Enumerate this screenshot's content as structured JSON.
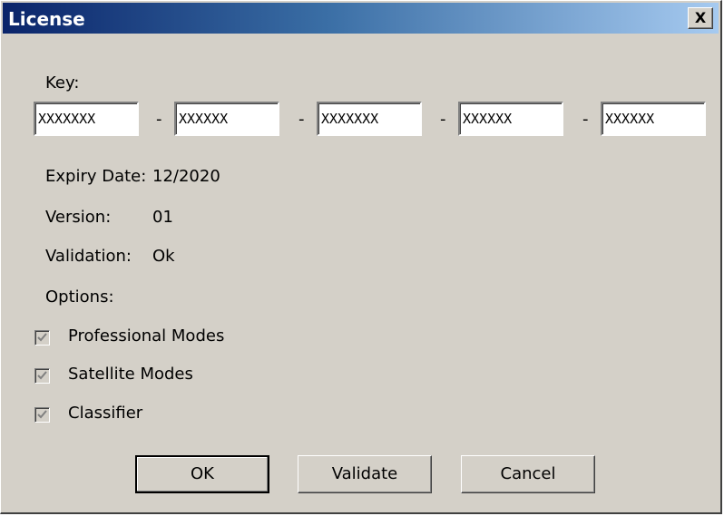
{
  "window": {
    "title": "License",
    "close_label": "X"
  },
  "key": {
    "label": "Key:",
    "fields": [
      "XXXXXXX",
      "XXXXXX",
      "XXXXXXX",
      "XXXXXX",
      "XXXXXX"
    ],
    "separator": "-"
  },
  "info": {
    "expiry_label": "Expiry Date:",
    "expiry_value": "12/2020",
    "version_label": "Version:",
    "version_value": "01",
    "validation_label": "Validation:",
    "validation_value": "Ok"
  },
  "options": {
    "label": "Options:",
    "items": [
      {
        "label": "Professional Modes",
        "checked": true,
        "disabled": true
      },
      {
        "label": "Satellite Modes",
        "checked": true,
        "disabled": true
      },
      {
        "label": "Classifier",
        "checked": true,
        "disabled": true
      }
    ]
  },
  "buttons": {
    "ok": "OK",
    "validate": "Validate",
    "cancel": "Cancel"
  },
  "colors": {
    "face": "#d4d0c8",
    "title_start": "#0a246a",
    "title_end": "#a6caf0"
  }
}
